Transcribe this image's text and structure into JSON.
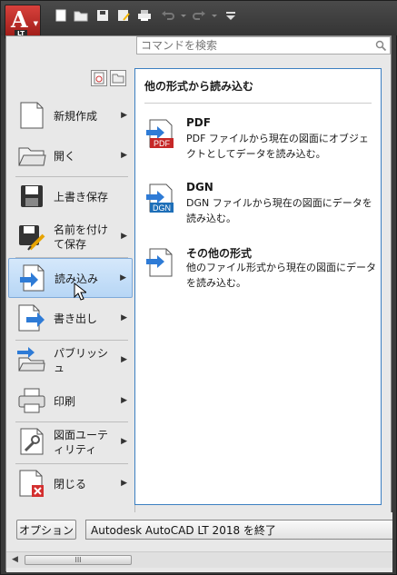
{
  "app": {
    "logo_letter": "A",
    "logo_badge": "LT"
  },
  "qat": {
    "icons": [
      "new-icon",
      "open-icon",
      "save-icon",
      "save-as-icon",
      "print-icon",
      "undo-icon",
      "redo-icon",
      "customize-icon"
    ]
  },
  "search": {
    "placeholder": "コマンドを検索"
  },
  "menu_items": [
    {
      "label": "新規作成",
      "icon": "new-document-icon",
      "has_arrow": true
    },
    {
      "label": "開く",
      "icon": "open-folder-icon",
      "has_arrow": true
    },
    {
      "label": "上書き保存",
      "icon": "save-icon",
      "has_arrow": false
    },
    {
      "label": "名前を付けて保存",
      "icon": "save-as-icon",
      "has_arrow": true
    },
    {
      "label": "読み込み",
      "icon": "import-icon",
      "has_arrow": true,
      "active": true
    },
    {
      "label": "書き出し",
      "icon": "export-icon",
      "has_arrow": true
    },
    {
      "label": "パブリッシュ",
      "icon": "publish-icon",
      "has_arrow": true
    },
    {
      "label": "印刷",
      "icon": "print-icon",
      "has_arrow": true
    },
    {
      "label": "図面ユーティリティ",
      "icon": "drawing-utilities-icon",
      "has_arrow": true
    },
    {
      "label": "閉じる",
      "icon": "close-document-icon",
      "has_arrow": true
    }
  ],
  "panel": {
    "title": "他の形式から読み込む",
    "entries": [
      {
        "name": "PDF",
        "desc": "PDF ファイルから現在の図面にオブジェクトとしてデータを読み込む。",
        "badge": "PDF",
        "badge_color": "#c62828"
      },
      {
        "name": "DGN",
        "desc": "DGN ファイルから現在の図面にデータを読み込む。",
        "badge": "DGN",
        "badge_color": "#1e6fb8"
      },
      {
        "name": "その他の形式",
        "desc": "他のファイル形式から現在の図面にデータを読み込む。",
        "badge": "",
        "badge_color": ""
      }
    ]
  },
  "footer": {
    "options_label": "オプション",
    "exit_label": "Autodesk AutoCAD LT 2018 を終了",
    "scroll_grip": "III"
  },
  "colors": {
    "accent_active": "#b7d6f5",
    "panel_border": "#3c7fc1"
  }
}
